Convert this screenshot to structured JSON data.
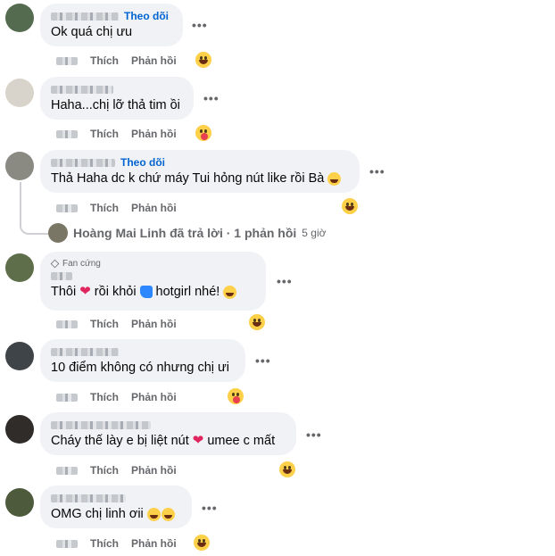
{
  "common": {
    "like_label": "Thích",
    "reply_label": "Phản hồi",
    "follow_label": "Theo dõi",
    "more_label": "•••"
  },
  "comments": [
    {
      "text": "Ok quá chị ưu",
      "follow": true,
      "reaction": "haha"
    },
    {
      "text": "Haha...chị lỡ thả tim ồi",
      "follow": false,
      "reaction": "care"
    },
    {
      "text": "Thả Haha dc k chứ máy Tui hỏng nút like rồi Bà",
      "follow": true,
      "reaction": "haha"
    },
    {
      "badge": "Fan cứng",
      "text_parts": [
        "Thôi",
        "rồi khỏi",
        "hotgirl nhé!"
      ],
      "reaction": "haha"
    },
    {
      "text": "10 điểm không có nhưng chị ưi",
      "reaction": "care"
    },
    {
      "text_parts": [
        "Cháy thế lày e bị liệt nút",
        "umee c mất"
      ],
      "reaction": "haha"
    },
    {
      "text": "OMG chị linh ơii",
      "reaction": "haha"
    }
  ],
  "reply_summary": {
    "text": "Hoàng Mai Linh đã trả lời · 1 phản hồi",
    "time": "5 giờ"
  },
  "colors": {
    "bubble": "#f0f2f5",
    "follow": "#0064d1",
    "muted": "#65676b",
    "heart": "#e0245e"
  }
}
